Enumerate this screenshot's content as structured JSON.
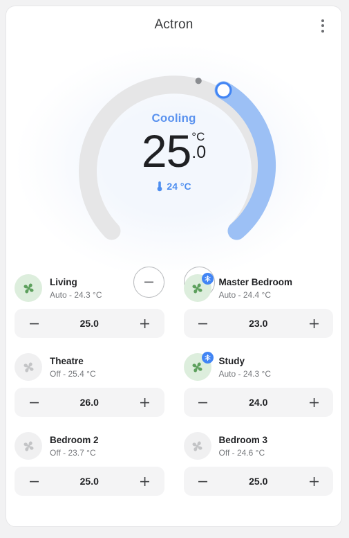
{
  "header": {
    "title": "Actron",
    "menu_icon": "more-vertical-icon"
  },
  "thermostat": {
    "mode": "Cooling",
    "target_int": "25",
    "target_decimal": ".0",
    "unit": "°C",
    "current_temp": "24 °C",
    "thermometer_icon": "thermometer-icon",
    "decrease_label": "−",
    "increase_label": "+",
    "dial": {
      "track_color": "#e6e6e7",
      "fill_color": "#9cc0f5",
      "handle_color": "#4285f4",
      "marker_color": "#8a8c90",
      "target_angle_deg": 35,
      "current_marker_angle_deg": 14
    },
    "accent_color": "#5b93ef"
  },
  "zones": [
    {
      "name": "Living",
      "status": "Auto - 24.3 °C",
      "value": "25.0",
      "state": "on",
      "icon": "fan-icon",
      "badge": null,
      "decrease_label": "−",
      "increase_label": "+"
    },
    {
      "name": "Master Bedroom",
      "status": "Auto - 24.4 °C",
      "value": "23.0",
      "state": "on",
      "icon": "fan-icon",
      "badge": "snowflake-icon",
      "decrease_label": "−",
      "increase_label": "+"
    },
    {
      "name": "Theatre",
      "status": "Off - 25.4 °C",
      "value": "26.0",
      "state": "off",
      "icon": "fan-icon",
      "badge": null,
      "decrease_label": "−",
      "increase_label": "+"
    },
    {
      "name": "Study",
      "status": "Auto - 24.3 °C",
      "value": "24.0",
      "state": "on",
      "icon": "fan-icon",
      "badge": "snowflake-icon",
      "decrease_label": "−",
      "increase_label": "+"
    },
    {
      "name": "Bedroom 2",
      "status": "Off - 23.7 °C",
      "value": "25.0",
      "state": "off",
      "icon": "fan-icon",
      "badge": null,
      "decrease_label": "−",
      "increase_label": "+"
    },
    {
      "name": "Bedroom 3",
      "status": "Off - 24.6 °C",
      "value": "25.0",
      "state": "off",
      "icon": "fan-icon",
      "badge": null,
      "decrease_label": "−",
      "increase_label": "+"
    }
  ],
  "colors": {
    "fan_on": "#5da05d",
    "fan_off": "#c3c4c6",
    "fan_disc_on": "#ddeedd",
    "fan_disc_off": "#f0f0f1",
    "badge_bg": "#4285f4"
  }
}
